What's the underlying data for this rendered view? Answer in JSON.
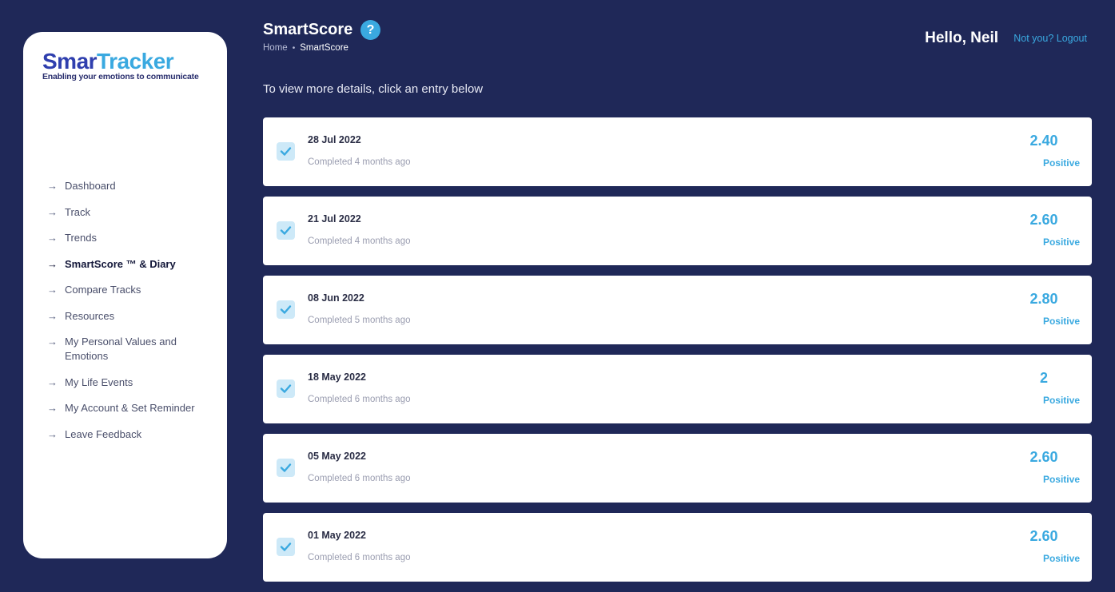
{
  "logo": {
    "word_part1": "Smar",
    "word_part2": "Tracker",
    "tagline": "Enabling your emotions to communicate"
  },
  "sidebar": {
    "items": [
      {
        "label": "Dashboard",
        "active": false
      },
      {
        "label": "Track",
        "active": false
      },
      {
        "label": "Trends",
        "active": false
      },
      {
        "label": "SmartScore ™ & Diary",
        "active": true
      },
      {
        "label": "Compare Tracks",
        "active": false
      },
      {
        "label": "Resources",
        "active": false
      },
      {
        "label": "My Personal Values and Emotions",
        "active": false
      },
      {
        "label": "My Life Events",
        "active": false
      },
      {
        "label": "My Account & Set Reminder",
        "active": false
      },
      {
        "label": "Leave Feedback",
        "active": false
      }
    ]
  },
  "header": {
    "title": "SmartScore",
    "help_symbol": "?",
    "breadcrumb": {
      "home": "Home",
      "separator": "•",
      "current": "SmartScore"
    },
    "greeting": "Hello, Neil",
    "logout": "Not you? Logout"
  },
  "main": {
    "instructions": "To view more details, click an entry below",
    "entries": [
      {
        "date": "28 Jul 2022",
        "status": "Completed 4 months ago",
        "score": "2.40",
        "label": "Positive"
      },
      {
        "date": "21 Jul 2022",
        "status": "Completed 4 months ago",
        "score": "2.60",
        "label": "Positive"
      },
      {
        "date": "08 Jun 2022",
        "status": "Completed 5 months ago",
        "score": "2.80",
        "label": "Positive"
      },
      {
        "date": "18 May 2022",
        "status": "Completed 6 months ago",
        "score": "2",
        "label": "Positive"
      },
      {
        "date": "05 May 2022",
        "status": "Completed 6 months ago",
        "score": "2.60",
        "label": "Positive"
      },
      {
        "date": "01 May 2022",
        "status": "Completed 6 months ago",
        "score": "2.60",
        "label": "Positive"
      }
    ]
  },
  "colors": {
    "background": "#1f2858",
    "accent": "#3aa9e0",
    "logo_smart": "#2f3fae"
  }
}
